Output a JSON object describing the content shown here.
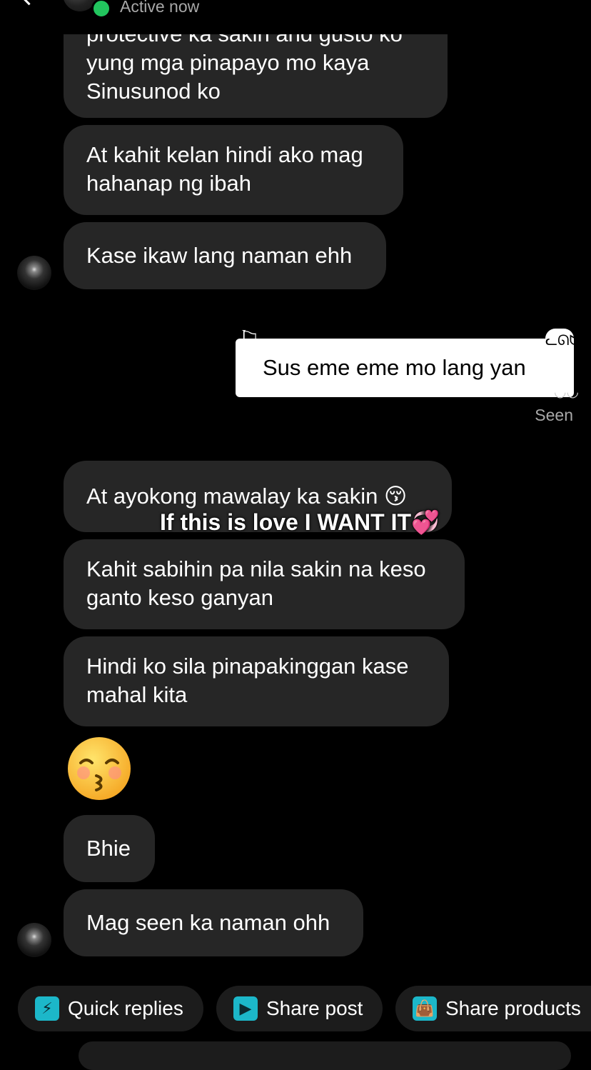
{
  "header": {
    "status": "Active now"
  },
  "messages": [
    {
      "text": "protective ka sakin and gusto ko yung mga pinapayo mo kaya Sinusunod ko"
    },
    {
      "text": "At kahit kelan hindi ako mag hahanap ng ibah"
    },
    {
      "text": "Kase ikaw lang naman ehh"
    },
    {
      "text": "Sus eme eme mo lang yan"
    },
    {
      "text": "At ayokong mawalay ka sakin 😚"
    },
    {
      "text": "Kahit sabihin pa nila sakin na keso ganto keso ganyan"
    },
    {
      "text": "Hindi ko sila pinapakinggan kase mahal kita"
    },
    {
      "text": "Bhie"
    },
    {
      "text": "Mag seen ka naman ohh"
    }
  ],
  "seen_label": "Seen",
  "overlay_caption": "If this is love I WANT IT💞",
  "chips": [
    {
      "label": "Quick replies",
      "icon": "lightning-icon"
    },
    {
      "label": "Share post",
      "icon": "play-icon"
    },
    {
      "label": "Share products",
      "icon": "shopping-bag-icon"
    }
  ],
  "colors": {
    "bubble": "#262626",
    "online": "#22c55e",
    "chip_icon": "#1cb7c9"
  }
}
